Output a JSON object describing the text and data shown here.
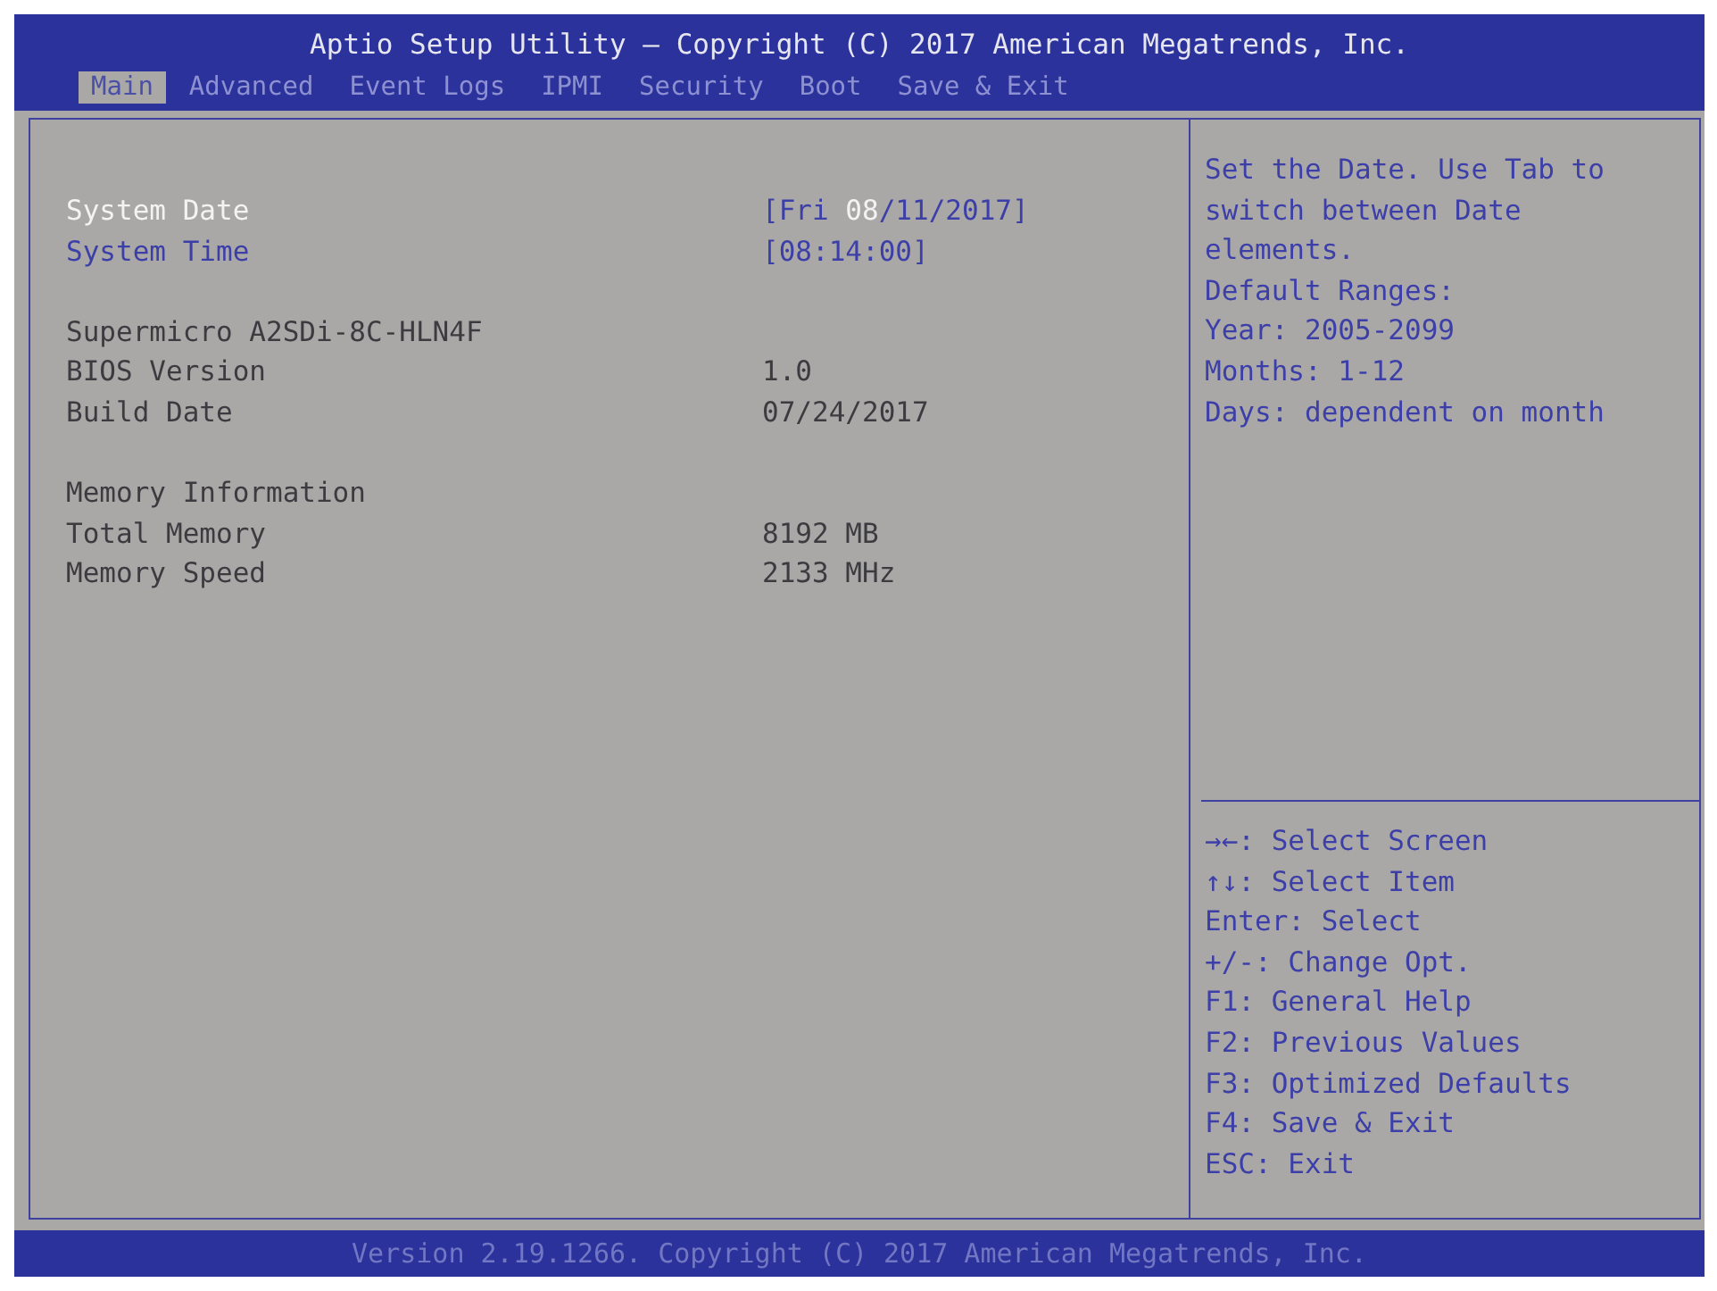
{
  "window": {
    "title": "Aptio Setup Utility – Copyright (C) 2017 American Megatrends, Inc."
  },
  "tabs": [
    {
      "label": "Main",
      "selected": true
    },
    {
      "label": "Advanced",
      "selected": false
    },
    {
      "label": "Event Logs",
      "selected": false
    },
    {
      "label": "IPMI",
      "selected": false
    },
    {
      "label": "Security",
      "selected": false
    },
    {
      "label": "Boot",
      "selected": false
    },
    {
      "label": "Save & Exit",
      "selected": false
    }
  ],
  "main_panel": {
    "groups": [
      {
        "rows": [
          {
            "kind": "setting",
            "label": "System Date",
            "selected": true,
            "segments": [
              {
                "text": "[Fri ",
                "selected": false
              },
              {
                "text": "08",
                "selected": true
              },
              {
                "text": "/11/2017]",
                "selected": false
              }
            ]
          },
          {
            "kind": "setting",
            "label": "System Time",
            "selected": false,
            "segments": [
              {
                "text": "[08:14:00]",
                "selected": false
              }
            ]
          }
        ]
      },
      {
        "rows": [
          {
            "kind": "info",
            "label": "Supermicro A2SDi-8C-HLN4F"
          },
          {
            "kind": "info",
            "label": "BIOS Version",
            "value": "1.0"
          },
          {
            "kind": "info",
            "label": "Build Date",
            "value": "07/24/2017"
          }
        ]
      },
      {
        "rows": [
          {
            "kind": "info",
            "label": "Memory Information"
          },
          {
            "kind": "info",
            "label": "Total Memory",
            "value": "8192 MB"
          },
          {
            "kind": "info",
            "label": "Memory Speed",
            "value": "2133 MHz"
          }
        ]
      }
    ]
  },
  "help": {
    "description": "Set the Date. Use Tab to switch between Date elements.",
    "lines": [
      "Default Ranges:",
      "Year: 2005-2099",
      "Months: 1-12",
      "Days: dependent on month"
    ]
  },
  "key_hints": [
    "→←: Select Screen",
    "↑↓: Select Item",
    "Enter: Select",
    "+/-: Change Opt.",
    "F1: General Help",
    "F2: Previous Values",
    "F3: Optimized Defaults",
    "F4: Save & Exit",
    "ESC: Exit"
  ],
  "status_bar": {
    "text": "Version 2.19.1266. Copyright (C) 2017 American Megatrends, Inc."
  }
}
